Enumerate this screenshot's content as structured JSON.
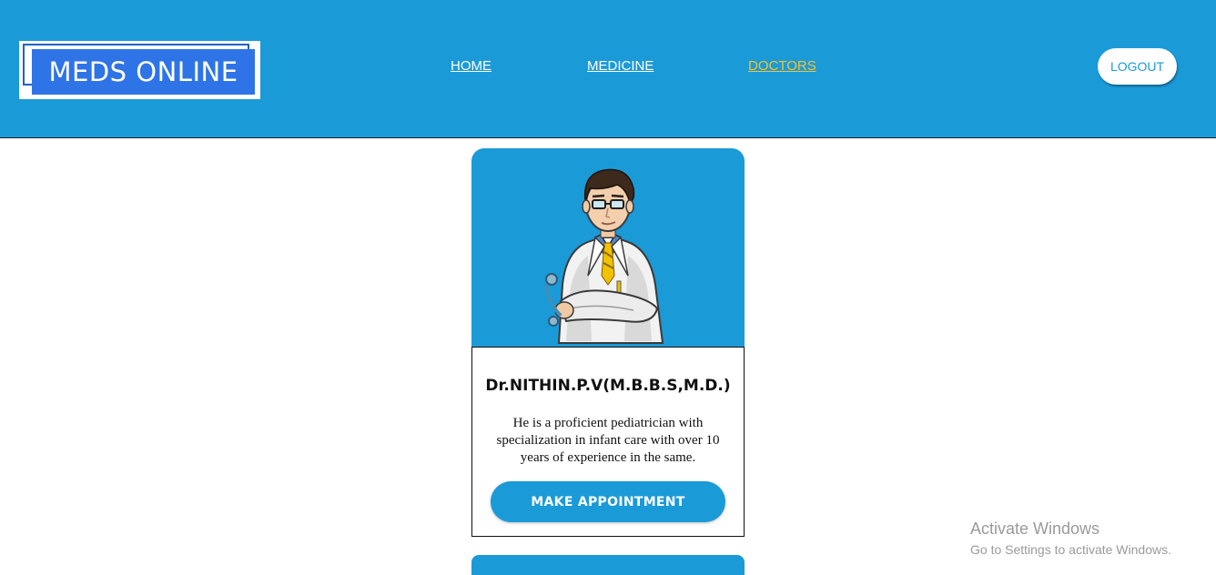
{
  "header": {
    "logo_text": "MEDS ONLINE",
    "nav": [
      {
        "label": "HOME"
      },
      {
        "label": "MEDICINE"
      },
      {
        "label": "DOCTORS",
        "active": true
      }
    ],
    "logout_label": "LOGOUT"
  },
  "doctor_card": {
    "image_icon": "doctor-illustration",
    "name": "Dr.NITHIN.P.V(M.B.B.S,M.D.)",
    "description": "He is a proficient pediatrician with specialization in infant care with over 10 years of experience in the same.",
    "button_label": "MAKE APPOINTMENT"
  },
  "watermark": {
    "title": "Activate Windows",
    "subtitle": "Go to Settings to activate Windows."
  },
  "colors": {
    "brand_blue": "#1b9ad8",
    "logo_blue": "#2f74e6",
    "active_nav": "#f1c232",
    "white": "#ffffff"
  }
}
